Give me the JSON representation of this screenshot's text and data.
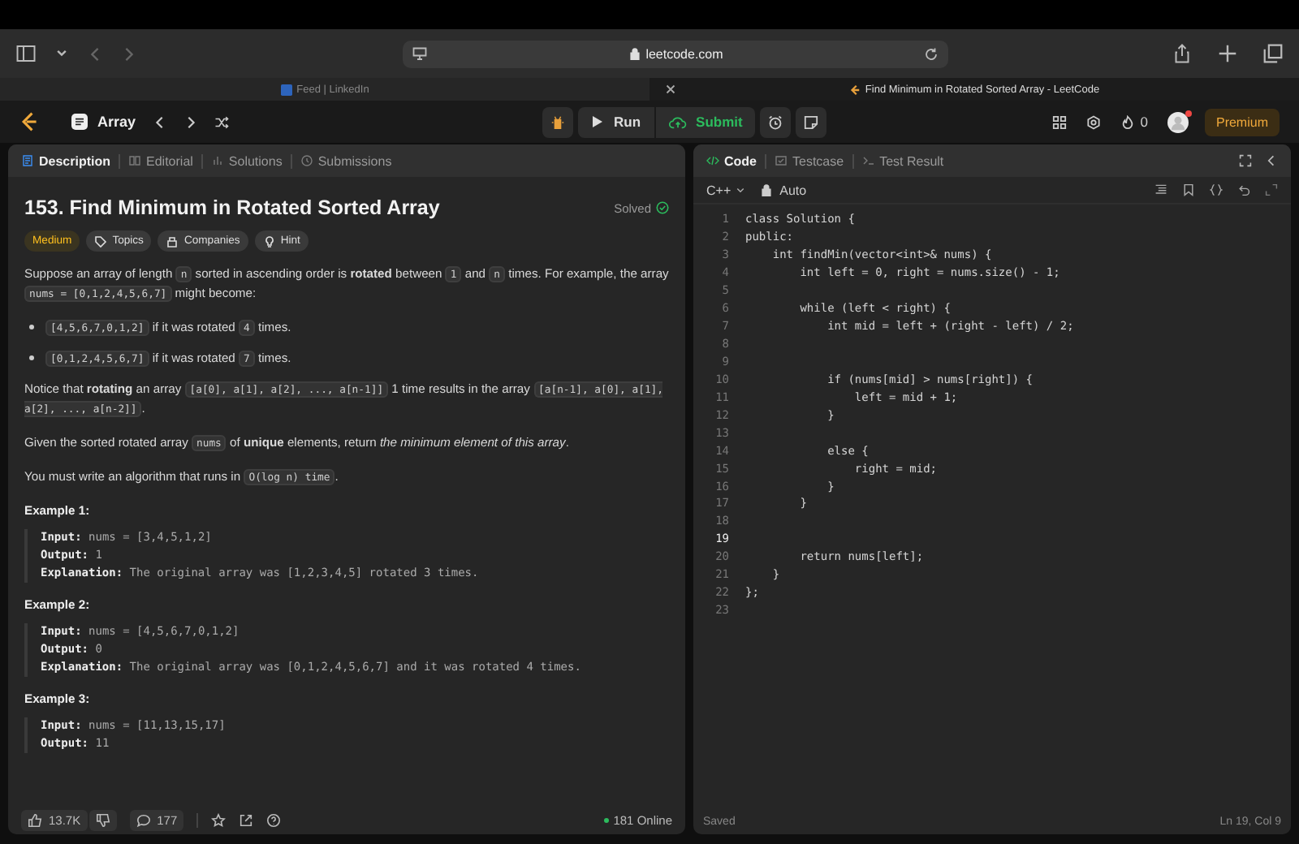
{
  "browser": {
    "address": "leetcode.com"
  },
  "tabs": [
    {
      "label": "Feed | LinkedIn",
      "selected": false
    },
    {
      "label": "Find Minimum in Rotated Sorted Array - LeetCode",
      "selected": true
    }
  ],
  "app_nav": {
    "problem_list": "Array",
    "run": "Run",
    "submit": "Submit",
    "streak": "0",
    "premium": "Premium"
  },
  "description_tabs": [
    {
      "label": "Description",
      "selected": true
    },
    {
      "label": "Editorial",
      "selected": false
    },
    {
      "label": "Solutions",
      "selected": false
    },
    {
      "label": "Submissions",
      "selected": false
    }
  ],
  "problem": {
    "title": "153. Find Minimum in Rotated Sorted Array",
    "status": "Solved",
    "difficulty": "Medium",
    "tags": [
      "Topics",
      "Companies",
      "Hint"
    ]
  },
  "blocks": [
    {
      "kind": "paragraph",
      "segments": [
        {
          "kind": "text",
          "text": "Suppose an array of length "
        },
        {
          "kind": "code",
          "text": "n"
        },
        {
          "kind": "text",
          "text": " sorted in ascending order is **rotated** between "
        },
        {
          "kind": "code",
          "text": "1"
        },
        {
          "kind": "text",
          "text": " and "
        },
        {
          "kind": "code",
          "text": "n"
        },
        {
          "kind": "text",
          "text": " times. For example, the array "
        },
        {
          "kind": "code",
          "text": "nums = [0,1,2,4,5,6,7]"
        },
        {
          "kind": "text",
          "text": " might become:"
        }
      ]
    },
    {
      "kind": "bullet",
      "segments": [
        {
          "kind": "code",
          "text": "[4,5,6,7,0,1,2]"
        },
        {
          "kind": "text",
          "text": " if it was rotated "
        },
        {
          "kind": "code",
          "text": "4"
        },
        {
          "kind": "text",
          "text": " times."
        }
      ]
    },
    {
      "kind": "bullet",
      "segments": [
        {
          "kind": "code",
          "text": "[0,1,2,4,5,6,7]"
        },
        {
          "kind": "text",
          "text": " if it was rotated "
        },
        {
          "kind": "code",
          "text": "7"
        },
        {
          "kind": "text",
          "text": " times."
        }
      ]
    },
    {
      "kind": "paragraph",
      "segments": [
        {
          "kind": "text",
          "text": "Notice that **rotating** an array "
        },
        {
          "kind": "code",
          "text": "[a[0], a[1], a[2], ..., a[n-1]]"
        },
        {
          "kind": "text",
          "text": " 1 time results in the array "
        },
        {
          "kind": "code",
          "text": "[a[n-1], a[0], a[1], a[2], ..., a[n-2]]"
        },
        {
          "kind": "text",
          "text": "."
        }
      ]
    },
    {
      "kind": "paragraph",
      "segments": [
        {
          "kind": "text",
          "text": "Given the sorted rotated array "
        },
        {
          "kind": "code",
          "text": "nums"
        },
        {
          "kind": "text",
          "text": " of **unique** elements, return *the minimum element of this array*."
        }
      ]
    },
    {
      "kind": "paragraph",
      "segments": [
        {
          "kind": "text",
          "text": "You must write an algorithm that runs in "
        },
        {
          "kind": "code",
          "text": "O(log n) time"
        },
        {
          "kind": "text",
          "text": "."
        }
      ]
    },
    {
      "kind": "example",
      "title": "Example 1:",
      "lines": [
        {
          "label": "Input:",
          "value": "nums = [3,4,5,1,2]"
        },
        {
          "label": "Output:",
          "value": "1"
        },
        {
          "label": "Explanation:",
          "value": "The original array was [1,2,3,4,5] rotated 3 times."
        }
      ]
    },
    {
      "kind": "example",
      "title": "Example 2:",
      "lines": [
        {
          "label": "Input:",
          "value": "nums = [4,5,6,7,0,1,2]"
        },
        {
          "label": "Output:",
          "value": "0"
        },
        {
          "label": "Explanation:",
          "value": "The original array was [0,1,2,4,5,6,7] and it was rotated 4 times."
        }
      ]
    },
    {
      "kind": "example",
      "title": "Example 3:",
      "lines": [
        {
          "label": "Input:",
          "value": "nums = [11,13,15,17]"
        },
        {
          "label": "Output:",
          "value": "11"
        }
      ]
    }
  ],
  "footer": {
    "likes": "13.7K",
    "comments": "177",
    "online": "181 Online"
  },
  "code_tabs": [
    {
      "label": "Code",
      "selected": true
    },
    {
      "label": "Testcase",
      "selected": false
    },
    {
      "label": "Test Result",
      "selected": false
    }
  ],
  "editor": {
    "language": "C++",
    "mode": "Auto",
    "status": "Saved",
    "position": "Ln 19, Col 9"
  },
  "code_lines": [
    {
      "number": "1",
      "code": "class Solution {",
      "selected": false
    },
    {
      "number": "2",
      "code": "public:",
      "selected": false
    },
    {
      "number": "3",
      "code": "    int findMin(vector<int>& nums) {",
      "selected": false
    },
    {
      "number": "4",
      "code": "        int left = 0, right = nums.size() - 1;",
      "selected": false
    },
    {
      "number": "5",
      "selected": false
    },
    {
      "number": "6",
      "code": "        while (left < right) {",
      "selected": false
    },
    {
      "number": "7",
      "code": "            int mid = left + (right - left) / 2;",
      "selected": false
    },
    {
      "number": "8",
      "selected": false
    },
    {
      "number": "9",
      "selected": false
    },
    {
      "number": "10",
      "code": "            if (nums[mid] > nums[right]) {",
      "selected": false
    },
    {
      "number": "11",
      "code": "                left = mid + 1;",
      "selected": false
    },
    {
      "number": "12",
      "code": "            }",
      "selected": false
    },
    {
      "number": "13",
      "selected": false
    },
    {
      "number": "14",
      "code": "            else {",
      "selected": false
    },
    {
      "number": "15",
      "code": "                right = mid;",
      "selected": false
    },
    {
      "number": "16",
      "code": "            }",
      "selected": false
    },
    {
      "number": "17",
      "code": "        }",
      "selected": false
    },
    {
      "number": "18",
      "selected": false
    },
    {
      "number": "19",
      "selected": true
    },
    {
      "number": "20",
      "code": "        return nums[left];",
      "selected": false
    },
    {
      "number": "21",
      "code": "    }",
      "selected": false
    },
    {
      "number": "22",
      "code": "};",
      "selected": false
    },
    {
      "number": "23",
      "selected": false
    }
  ]
}
